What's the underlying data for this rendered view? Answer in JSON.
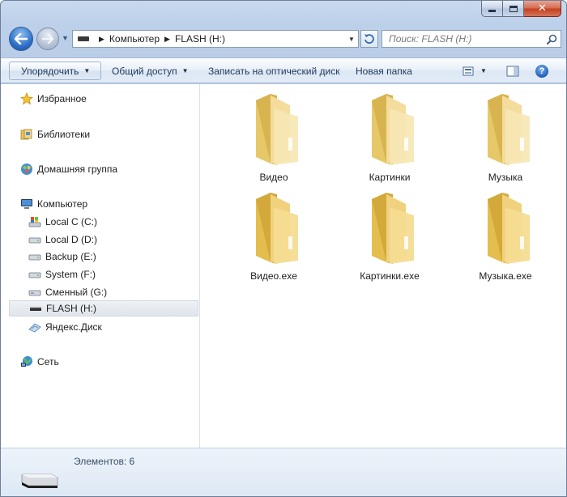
{
  "window": {
    "colors": {
      "frame": "#bcd0ea",
      "close_button": "#c2401f",
      "selection": "#dfe5ec"
    }
  },
  "address": {
    "segments": [
      "Компьютер",
      "FLASH (H:)"
    ]
  },
  "search": {
    "placeholder": "Поиск: FLASH (H:)"
  },
  "toolbar": {
    "organize_label": "Упорядочить",
    "share_label": "Общий доступ",
    "burn_label": "Записать на оптический диск",
    "new_folder_label": "Новая папка",
    "help_label": "?"
  },
  "sidebar": {
    "favorites": {
      "label": "Избранное",
      "icon": "star-icon"
    },
    "libraries": {
      "label": "Библиотеки",
      "icon": "libraries-icon"
    },
    "homegroup": {
      "label": "Домашняя группа",
      "icon": "homegroup-icon"
    },
    "computer": {
      "label": "Компьютер",
      "icon": "computer-icon"
    },
    "drives": [
      {
        "label": "Local C (C:)",
        "icon": "system-drive-icon"
      },
      {
        "label": "Local D (D:)",
        "icon": "drive-icon"
      },
      {
        "label": "Backup (E:)",
        "icon": "drive-icon"
      },
      {
        "label": "System (F:)",
        "icon": "drive-icon"
      },
      {
        "label": "Сменный (G:)",
        "icon": "removable-drive-icon"
      },
      {
        "label": "FLASH (H:)",
        "icon": "usb-drive-icon",
        "selected": true
      },
      {
        "label": "Яндекс.Диск",
        "icon": "yandex-disk-icon"
      }
    ],
    "network": {
      "label": "Сеть",
      "icon": "network-icon"
    }
  },
  "files": [
    {
      "name": "Видео",
      "icon": "folder-icon"
    },
    {
      "name": "Картинки",
      "icon": "folder-icon"
    },
    {
      "name": "Музыка",
      "icon": "folder-icon"
    },
    {
      "name": "Видео.exe",
      "icon": "folder-icon"
    },
    {
      "name": "Картинки.exe",
      "icon": "folder-icon"
    },
    {
      "name": "Музыка.exe",
      "icon": "folder-icon"
    }
  ],
  "status": {
    "items_count": "Элементов: 6"
  }
}
